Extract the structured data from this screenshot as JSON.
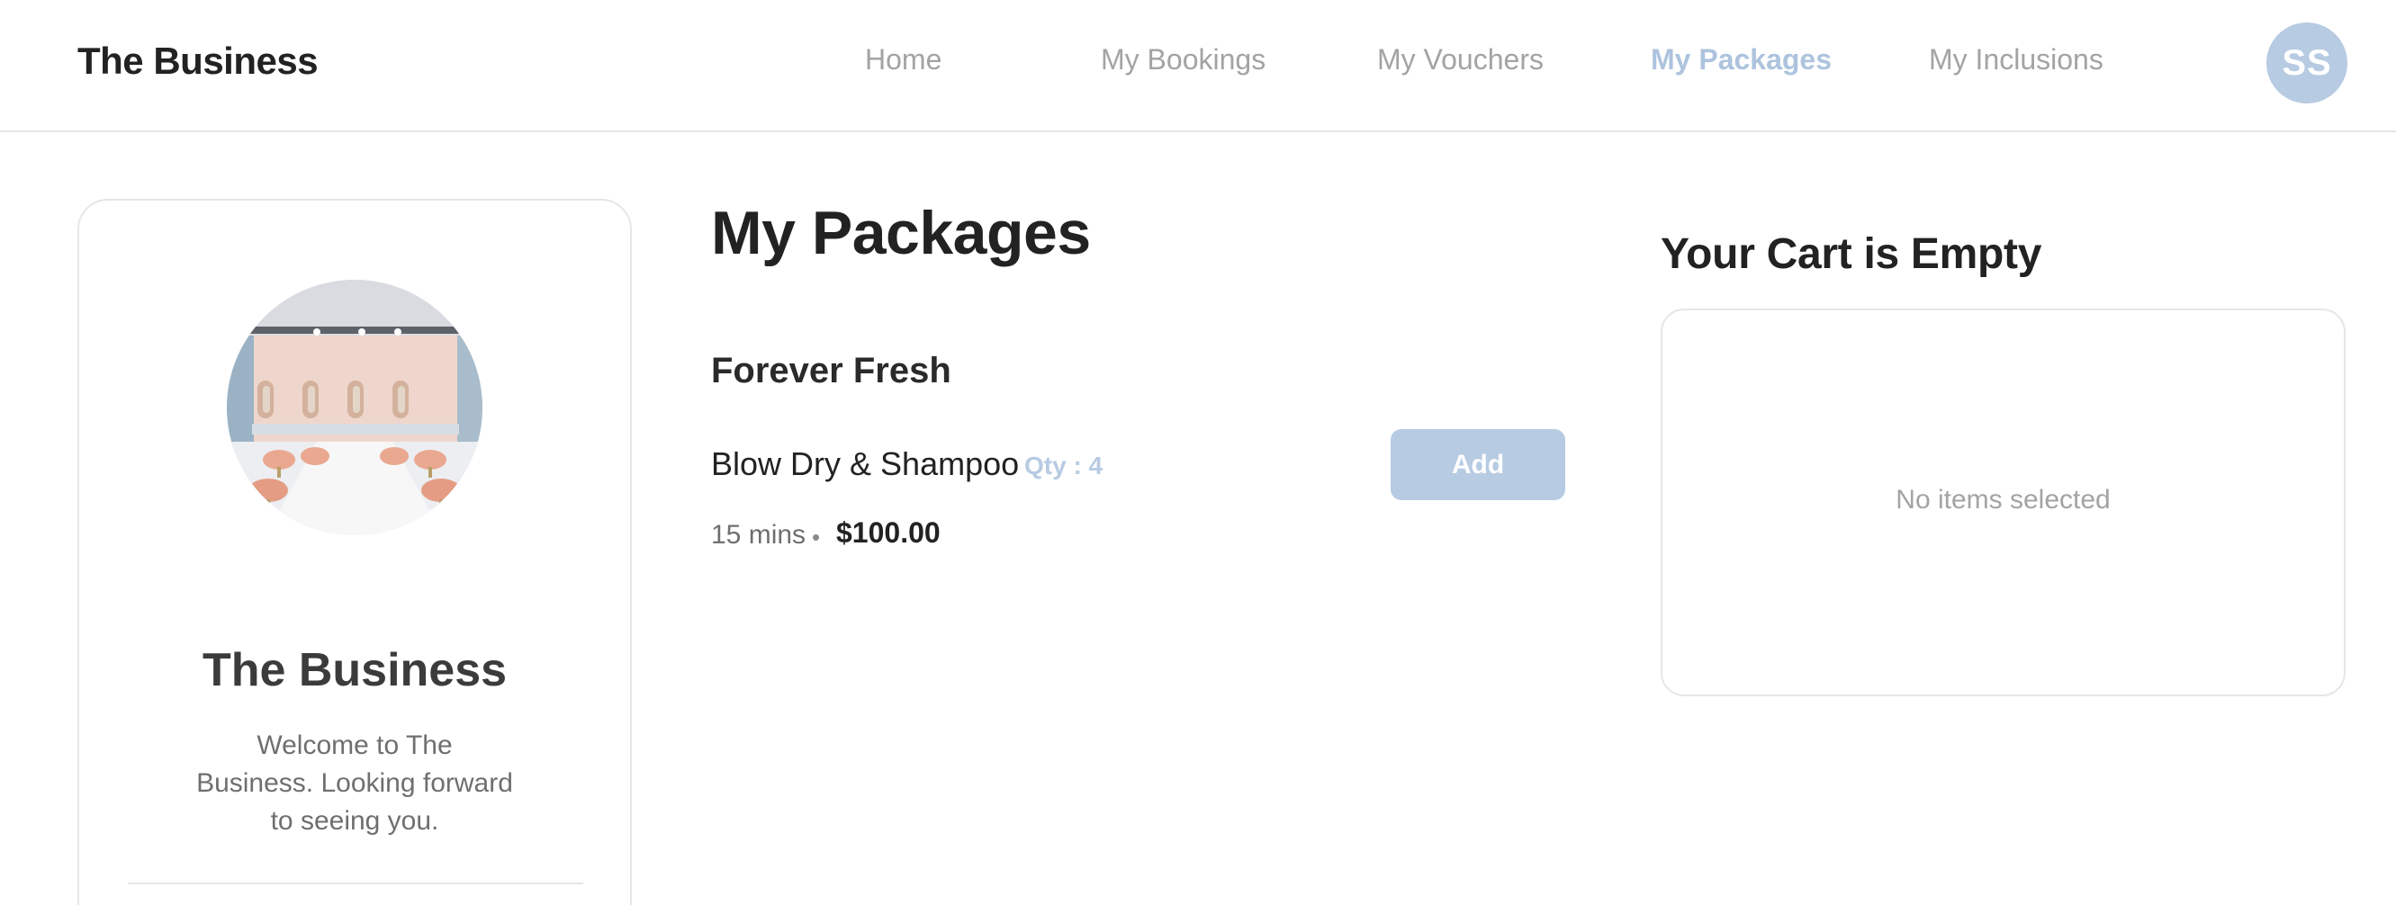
{
  "header": {
    "brand": "The Business",
    "nav": [
      {
        "label": "Home",
        "active": false
      },
      {
        "label": "My Bookings",
        "active": false
      },
      {
        "label": "My Vouchers",
        "active": false
      },
      {
        "label": "My Packages",
        "active": true
      },
      {
        "label": "My Inclusions",
        "active": false
      }
    ],
    "avatar_initials": "SS"
  },
  "profile_card": {
    "photo_icon": "salon-interior-photo",
    "title": "The Business",
    "description": "Welcome to The Business. Looking forward to seeing you."
  },
  "packages": {
    "page_title": "My Packages",
    "package_name": "Forever Fresh",
    "service": {
      "name": "Blow Dry & Shampoo",
      "qty": "Qty : 4",
      "duration": "15 mins",
      "separator": "•",
      "price": "$100.00",
      "add_label": "Add"
    }
  },
  "cart": {
    "title": "Your Cart is Empty",
    "empty_text": "No items selected"
  },
  "colors": {
    "accent": "#b7cbe2",
    "active_nav": "#adc3de",
    "muted_text": "#a3a3a3",
    "border": "#e6e6e6"
  }
}
